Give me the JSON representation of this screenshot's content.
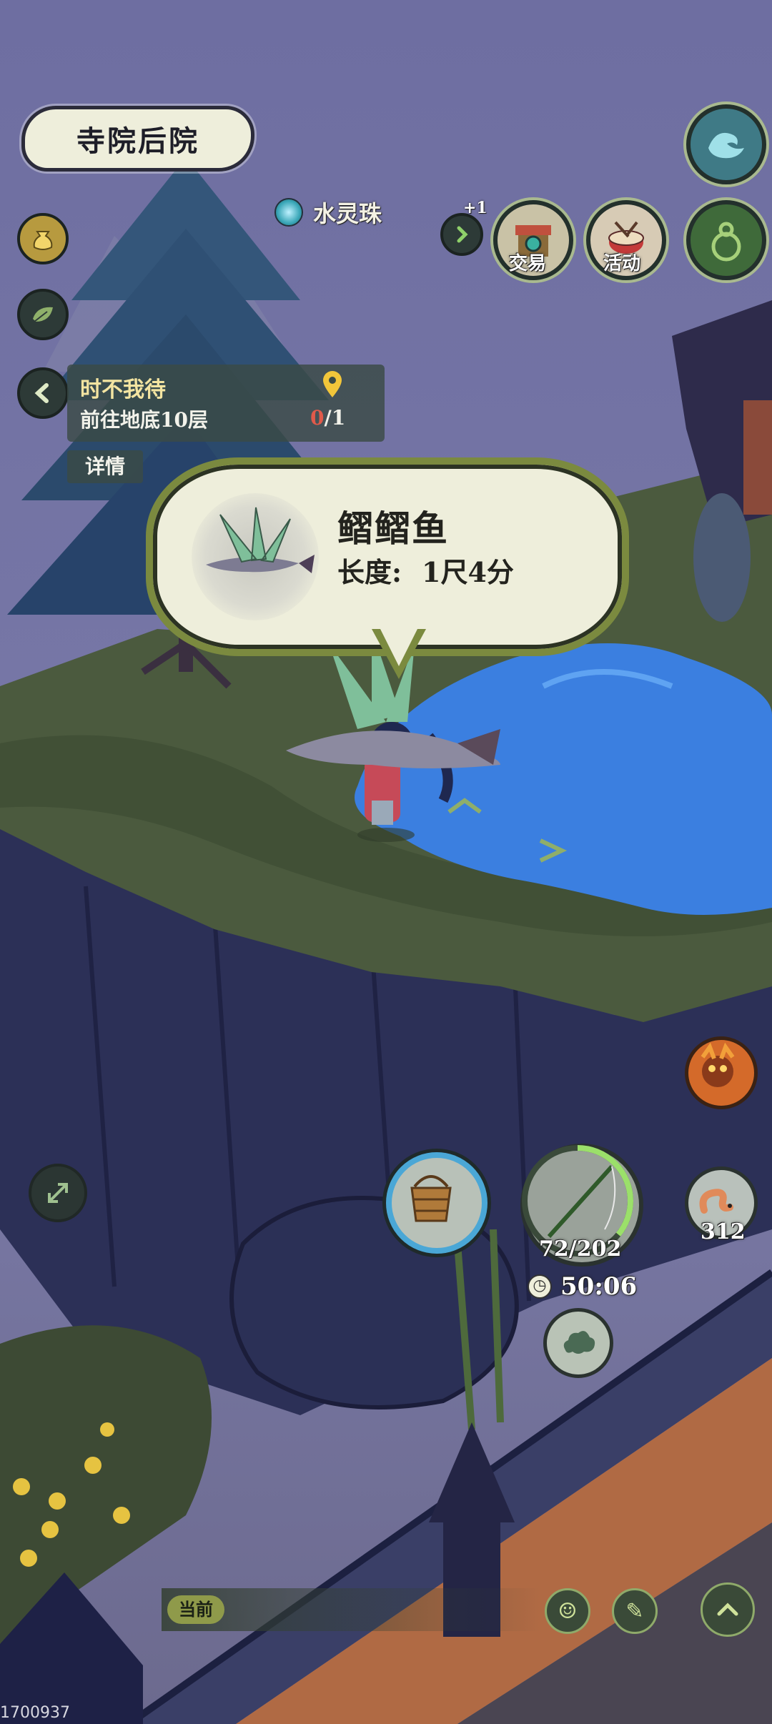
{
  "location": {
    "name": "寺院后院"
  },
  "resource": {
    "name": "水灵珠"
  },
  "top_right": {
    "plus_badge": "+1",
    "trade_label": "交易",
    "activity_label": "活动"
  },
  "quest": {
    "title": "时不我待",
    "description": "前往地底10层",
    "progress_current": "0",
    "progress_total": "/1",
    "details_button": "详情"
  },
  "catch_popup": {
    "fish_name": "鳛鳛鱼",
    "length_label": "长度:",
    "length_value": "1尺4分"
  },
  "hud": {
    "rod_durability": "72/202",
    "rod_durability_fraction": 0.36,
    "timer": "50:06",
    "bait_count": "312"
  },
  "chat": {
    "tag": "当前"
  },
  "footer": {
    "id": "1700937"
  },
  "colors": {
    "sky": "#6f6f9c",
    "grass": "#4b5a3e",
    "cliff": "#2c3057",
    "water": "#3b7fe0",
    "bubble_fill": "#eeeedb",
    "bubble_border": "#7b8a3f",
    "quest_count_current": "#e05a4a"
  },
  "icons": [
    "money-bag-icon",
    "leaf-icon",
    "chevron-left-icon",
    "location-pin-icon",
    "water-orb-icon",
    "chevron-right-icon",
    "trade-stall-icon",
    "drum-icon",
    "wave-icon",
    "gourd-icon",
    "bucket-icon",
    "fishing-rod-icon",
    "clock-icon",
    "cloud-icon",
    "worm-icon",
    "monster-icon",
    "expand-icon",
    "smile-icon",
    "emote-icon",
    "chevron-up-icon"
  ]
}
